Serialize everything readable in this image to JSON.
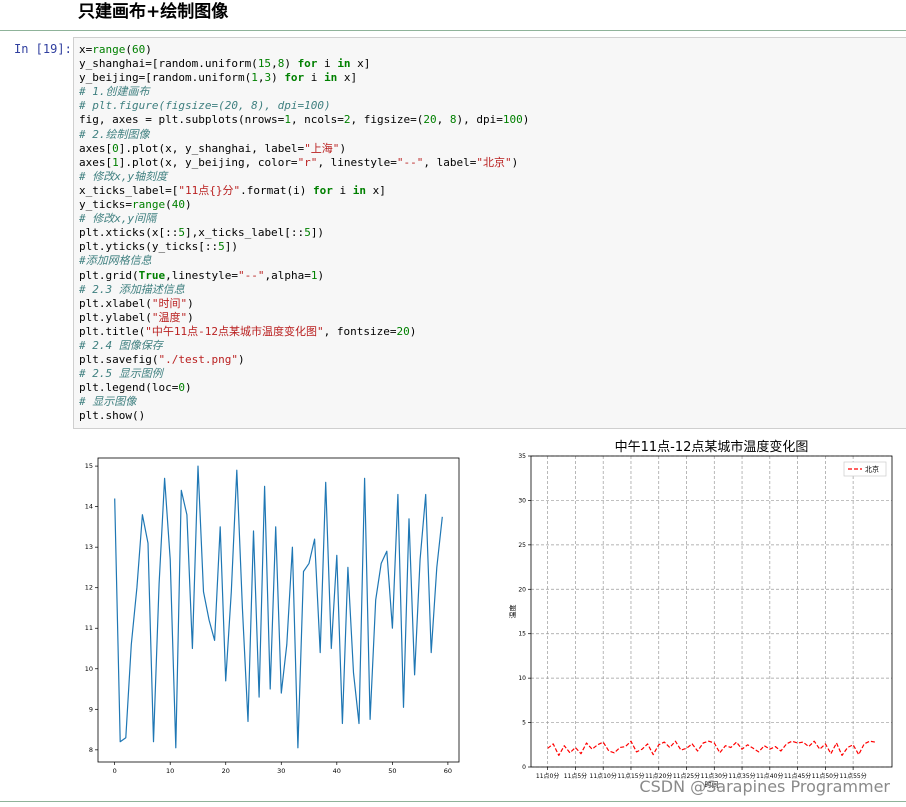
{
  "section": {
    "heading": "只建画布+绘制图像"
  },
  "cell": {
    "prompt": "In [19]:",
    "lines": [
      "x=range(60)",
      "y_shanghai=[random.uniform(15,8) for i in x]",
      "y_beijing=[random.uniform(1,3) for i in x]",
      "# 1.创建画布",
      "# plt.figure(figsize=(20, 8), dpi=100)",
      "fig, axes = plt.subplots(nrows=1, ncols=2, figsize=(20, 8), dpi=100)",
      "# 2.绘制图像",
      "axes[0].plot(x, y_shanghai, label=\"上海\")",
      "axes[1].plot(x, y_beijing, color=\"r\", linestyle=\"--\", label=\"北京\")",
      "# 修改x,y轴刻度",
      "x_ticks_label=[\"11点{}分\".format(i) for i in x]",
      "y_ticks=range(40)",
      "# 修改x,y间隔",
      "plt.xticks(x[::5],x_ticks_label[::5])",
      "plt.yticks(y_ticks[::5])",
      "#添加网格信息",
      "plt.grid(True,linestyle=\"--\",alpha=1)",
      "# 2.3 添加描述信息",
      "plt.xlabel(\"时间\")",
      "plt.ylabel(\"温度\")",
      "plt.title(\"中午11点-12点某城市温度变化图\", fontsize=20)",
      "# 2.4 图像保存",
      "plt.savefig(\"./test.png\")",
      "# 2.5 显示图例",
      "plt.legend(loc=0)",
      "# 显示图像",
      "plt.show()"
    ]
  },
  "output": {
    "watermark": "CSDN @Sarapines Programmer"
  },
  "chart_data": [
    {
      "type": "line",
      "title": "",
      "xlabel": "",
      "ylabel": "",
      "xlim": [
        -3,
        62
      ],
      "ylim": [
        7.7,
        15.2
      ],
      "x_ticks": [
        0,
        10,
        20,
        30,
        40,
        50,
        60
      ],
      "y_ticks": [
        8,
        9,
        10,
        11,
        12,
        13,
        14,
        15
      ],
      "grid": false,
      "series": [
        {
          "name": "",
          "color": "#1f77b4",
          "style": "solid",
          "x": [
            0,
            1,
            2,
            3,
            4,
            5,
            6,
            7,
            8,
            9,
            10,
            11,
            12,
            13,
            14,
            15,
            16,
            17,
            18,
            19,
            20,
            21,
            22,
            23,
            24,
            25,
            26,
            27,
            28,
            29,
            30,
            31,
            32,
            33,
            34,
            35,
            36,
            37,
            38,
            39,
            40,
            41,
            42,
            43,
            44,
            45,
            46,
            47,
            48,
            49,
            50,
            51,
            52,
            53,
            54,
            55,
            56,
            57,
            58,
            59
          ],
          "values": [
            14.2,
            8.2,
            8.3,
            10.6,
            12.0,
            13.8,
            13.1,
            8.2,
            12.1,
            14.7,
            12.7,
            8.05,
            14.4,
            13.8,
            10.5,
            15.0,
            11.9,
            11.2,
            10.7,
            13.5,
            9.7,
            11.9,
            14.9,
            11.5,
            8.7,
            13.4,
            9.3,
            14.5,
            9.5,
            13.5,
            9.4,
            10.6,
            13.0,
            8.05,
            12.4,
            12.6,
            13.2,
            10.4,
            14.6,
            10.5,
            12.8,
            8.65,
            12.5,
            9.9,
            8.65,
            14.7,
            8.75,
            11.7,
            12.6,
            12.9,
            11.0,
            14.3,
            9.05,
            13.7,
            9.85,
            12.7,
            14.3,
            10.4,
            12.5,
            13.75
          ]
        }
      ]
    },
    {
      "type": "line",
      "title": "中午11点-12点某城市温度变化图",
      "xlabel": "时间",
      "ylabel": "温度",
      "xlim": [
        -3,
        62
      ],
      "ylim": [
        0,
        35
      ],
      "x_ticks": [
        0,
        5,
        10,
        15,
        20,
        25,
        30,
        35,
        40,
        45,
        50,
        55
      ],
      "x_tick_labels": [
        "11点0分",
        "11点5分",
        "11点10分",
        "11点15分",
        "11点20分",
        "11点25分",
        "11点30分",
        "11点35分",
        "11点40分",
        "11点45分",
        "11点50分",
        "11点55分"
      ],
      "y_ticks": [
        0,
        5,
        10,
        15,
        20,
        25,
        30,
        35
      ],
      "grid": true,
      "legend": "top-right",
      "series": [
        {
          "name": "北京",
          "color": "#ff0000",
          "style": "dashed",
          "x": [
            0,
            1,
            2,
            3,
            4,
            5,
            6,
            7,
            8,
            9,
            10,
            11,
            12,
            13,
            14,
            15,
            16,
            17,
            18,
            19,
            20,
            21,
            22,
            23,
            24,
            25,
            26,
            27,
            28,
            29,
            30,
            31,
            32,
            33,
            34,
            35,
            36,
            37,
            38,
            39,
            40,
            41,
            42,
            43,
            44,
            45,
            46,
            47,
            48,
            49,
            50,
            51,
            52,
            53,
            54,
            55,
            56,
            57,
            58,
            59
          ],
          "values": [
            2.1,
            2.6,
            1.3,
            2.4,
            1.6,
            2.2,
            1.5,
            2.7,
            2.0,
            2.5,
            2.8,
            1.8,
            1.6,
            2.2,
            2.3,
            2.9,
            1.7,
            2.0,
            2.6,
            1.4,
            2.5,
            2.8,
            2.2,
            2.9,
            1.9,
            2.1,
            2.6,
            1.8,
            2.7,
            2.9,
            2.7,
            1.6,
            2.4,
            2.2,
            2.8,
            2.0,
            2.5,
            2.1,
            1.7,
            2.4,
            2.0,
            2.3,
            1.8,
            2.6,
            2.9,
            2.7,
            2.8,
            2.3,
            2.9,
            2.0,
            2.6,
            1.5,
            2.7,
            1.3,
            2.2,
            2.5,
            1.4,
            2.6,
            2.9,
            2.8
          ]
        }
      ]
    }
  ]
}
